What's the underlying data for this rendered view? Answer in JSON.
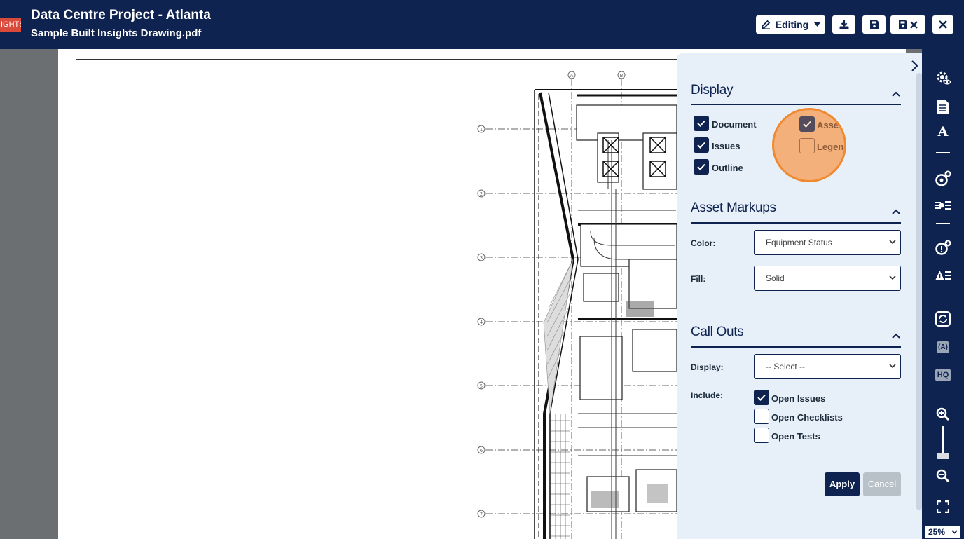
{
  "header": {
    "brand_tag": "IGHTS",
    "project_title": "Data Centre Project - Atlanta",
    "document_name": "Sample Built Insights Drawing.pdf",
    "mode_button_label": "Editing",
    "background_color": "#0f2350",
    "brand_color": "#d94a3b"
  },
  "drawing": {
    "grid_labels": [
      "A",
      "B",
      "1",
      "2",
      "3",
      "4",
      "5",
      "6",
      "7"
    ]
  },
  "panel": {
    "display": {
      "title": "Display",
      "options": [
        {
          "label": "Document",
          "checked": true
        },
        {
          "label": "Issues",
          "checked": true
        },
        {
          "label": "Outline",
          "checked": true
        },
        {
          "label": "Assets",
          "checked": true
        },
        {
          "label": "Legend",
          "checked": false
        }
      ]
    },
    "asset_markups": {
      "title": "Asset Markups",
      "color_label": "Color:",
      "color_value": "Equipment Status",
      "fill_label": "Fill:",
      "fill_value": "Solid"
    },
    "call_outs": {
      "title": "Call Outs",
      "display_label": "Display:",
      "display_value": "-- Select --",
      "include_label": "Include:",
      "include_options": [
        {
          "label": "Open Issues",
          "checked": true
        },
        {
          "label": "Open Checklists",
          "checked": false
        },
        {
          "label": "Open Tests",
          "checked": false
        }
      ]
    },
    "apply_label": "Apply",
    "cancel_label": "Cancel"
  },
  "toolbar": {
    "text_icon_glyph": "A",
    "ai_label": "(A)",
    "hq_label": "HQ",
    "zoom_value": "25%"
  }
}
